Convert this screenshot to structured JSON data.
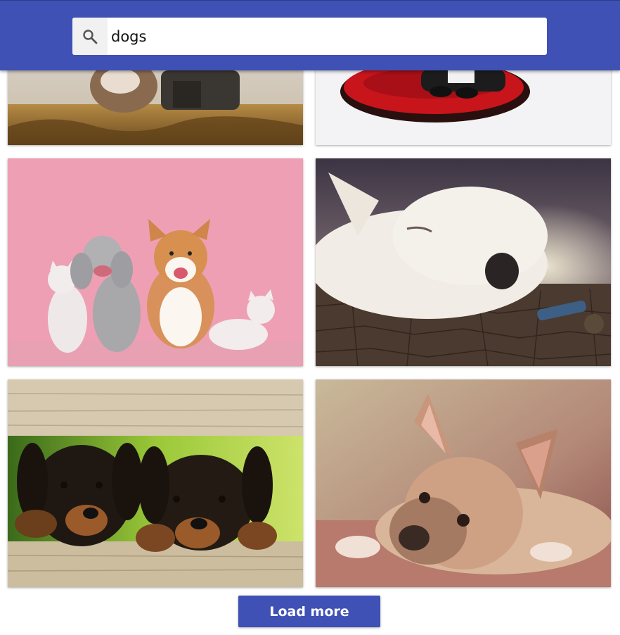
{
  "search": {
    "value": "dogs",
    "icon": "search-icon"
  },
  "results": [
    {
      "name": "photo-dog-and-person-in-field",
      "alt": ""
    },
    {
      "name": "photo-dog-on-red-cushion",
      "alt": ""
    },
    {
      "name": "photo-poodle-corgi-and-cats-on-pink",
      "alt": ""
    },
    {
      "name": "photo-white-dog-sleeping-on-cracked-earth",
      "alt": ""
    },
    {
      "name": "photo-rottweiler-puppies-on-fence",
      "alt": ""
    },
    {
      "name": "photo-french-bulldog-lying-down",
      "alt": ""
    }
  ],
  "load_more": {
    "label": "Load more"
  },
  "colors": {
    "primary": "#3f51b5",
    "background": "#ffffff"
  }
}
